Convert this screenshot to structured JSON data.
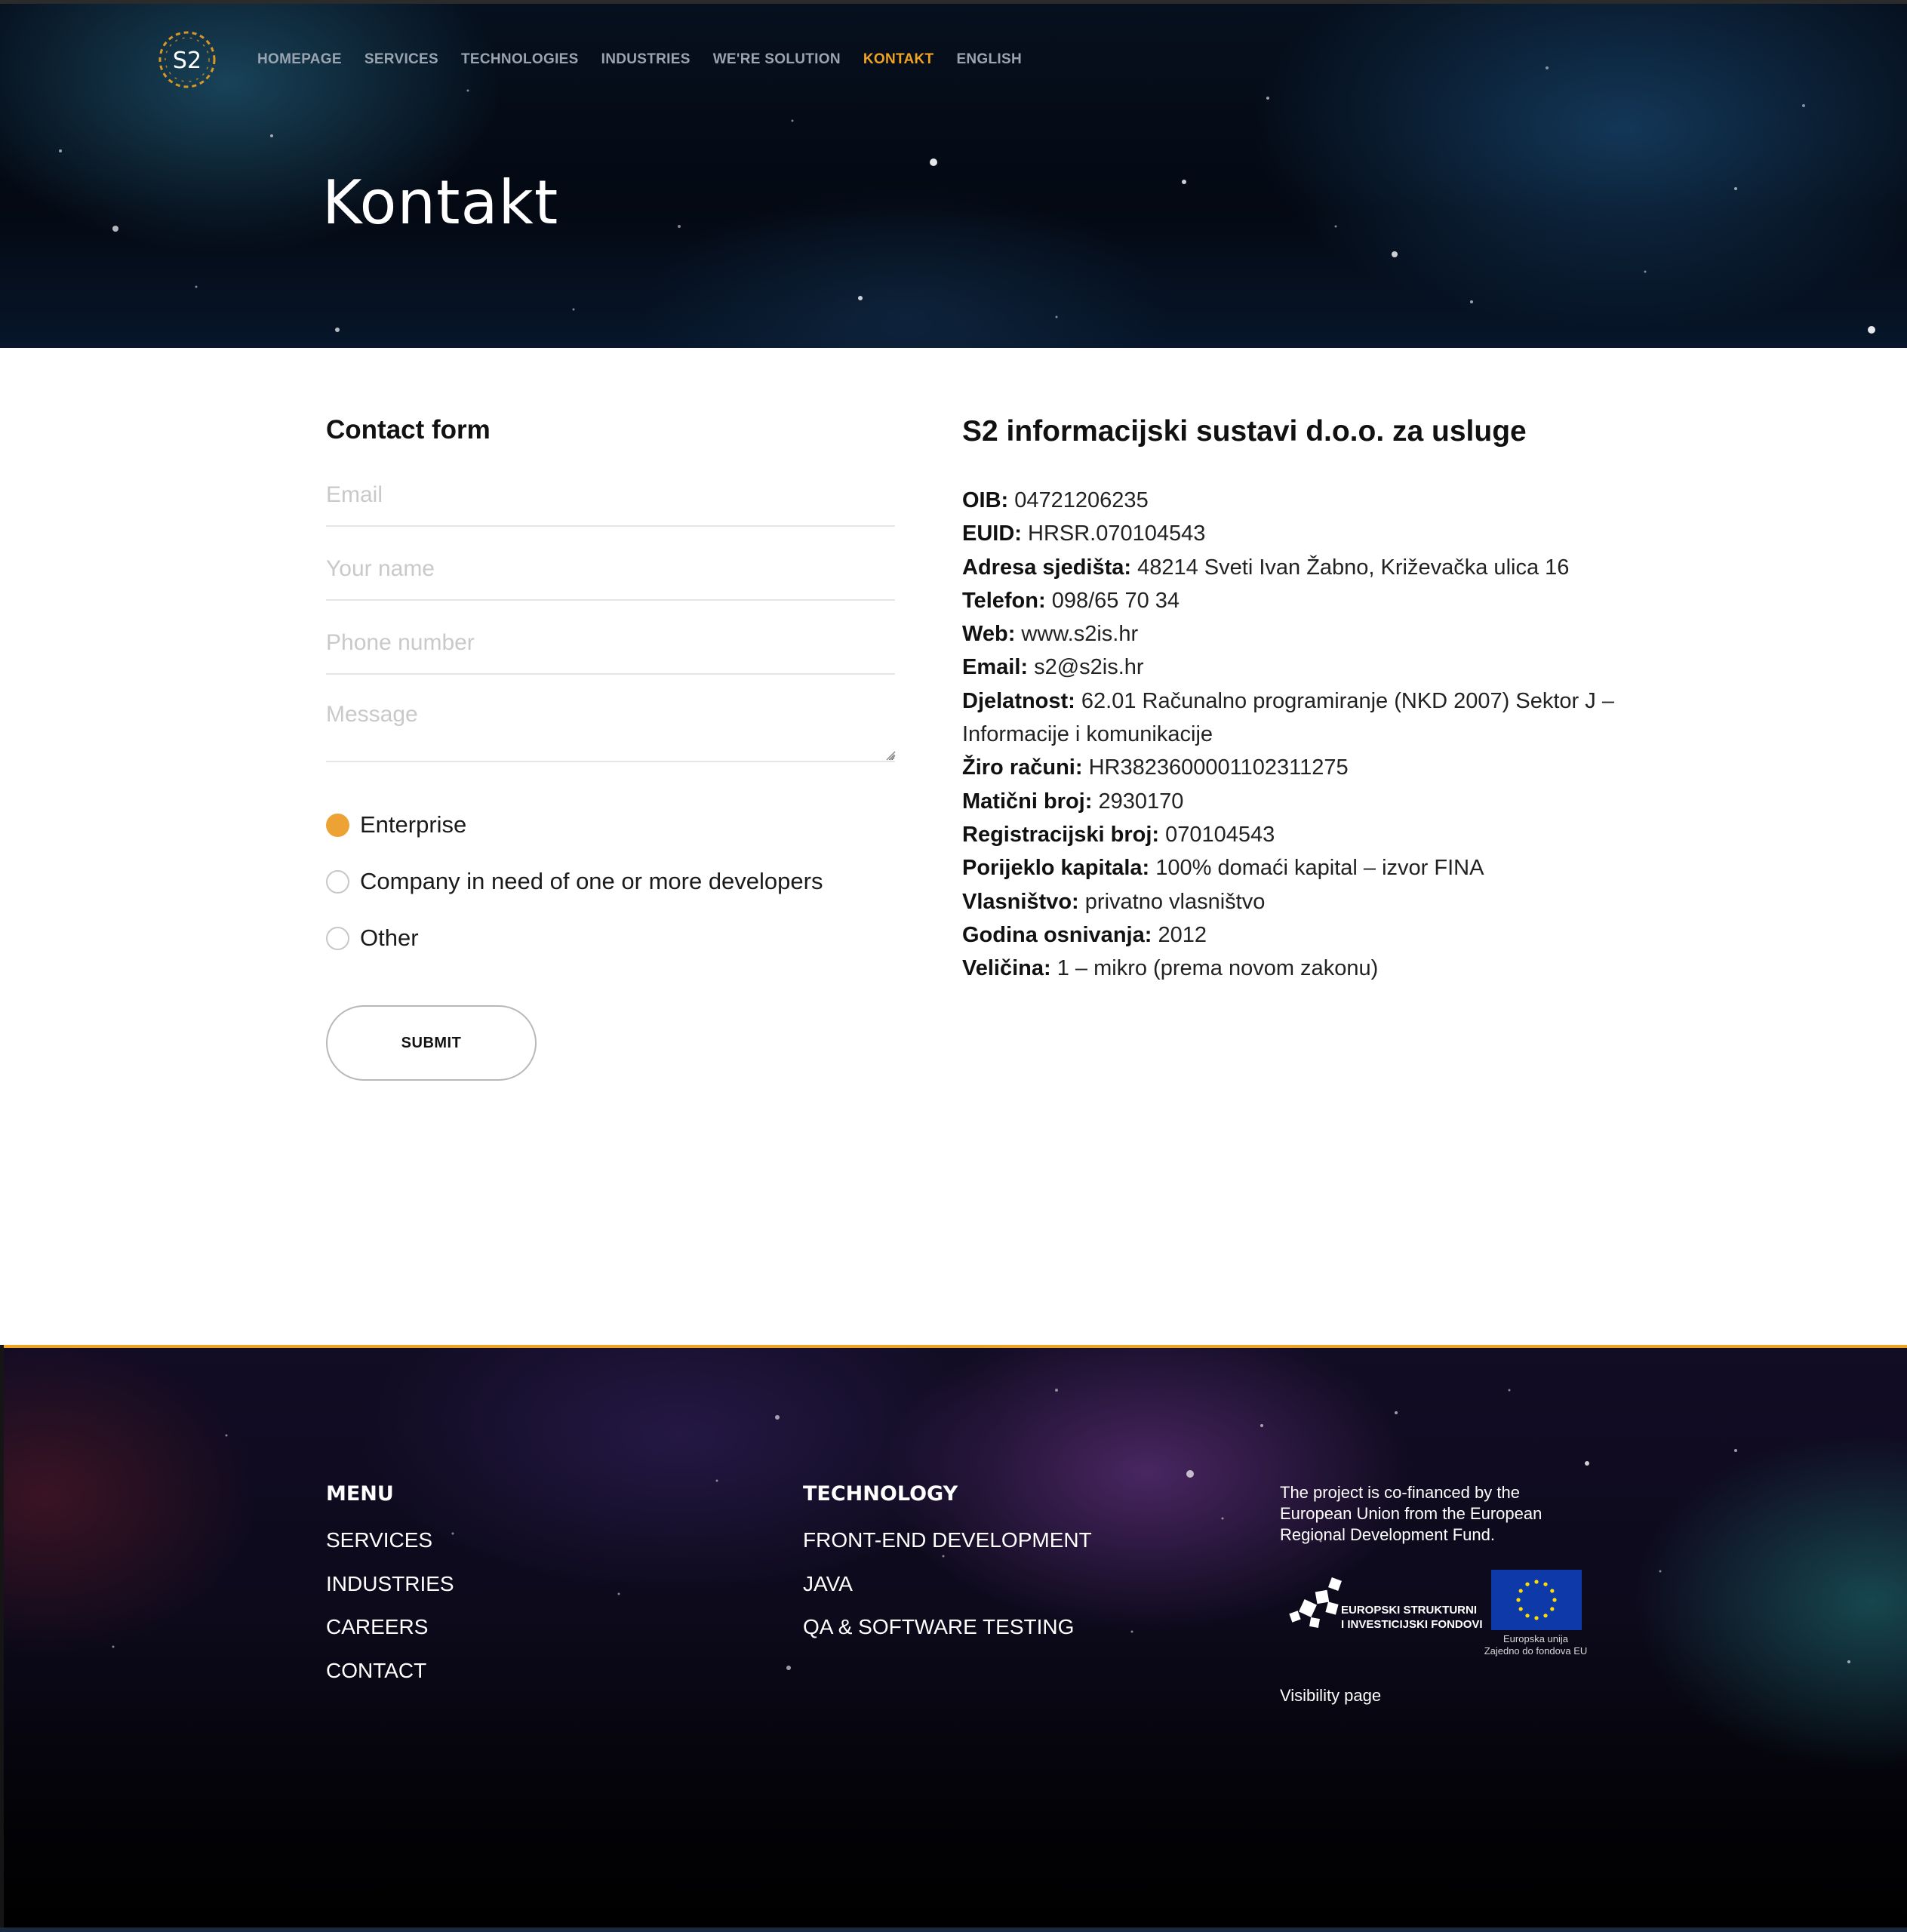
{
  "header": {
    "logo_text": "S2",
    "nav": [
      {
        "label": "HOMEPAGE",
        "active": false
      },
      {
        "label": "SERVICES",
        "active": false
      },
      {
        "label": "TECHNOLOGIES",
        "active": false
      },
      {
        "label": "INDUSTRIES",
        "active": false
      },
      {
        "label": "WE'RE SOLUTION",
        "active": false
      },
      {
        "label": "KONTAKT",
        "active": true
      },
      {
        "label": "ENGLISH",
        "active": false
      }
    ],
    "accent_color": "#f0a221"
  },
  "hero": {
    "title": "Kontakt"
  },
  "contact_form": {
    "title": "Contact form",
    "email_placeholder": "Email",
    "name_placeholder": "Your name",
    "phone_placeholder": "Phone number",
    "message_placeholder": "Message",
    "options": [
      {
        "label": "Enterprise",
        "checked": true
      },
      {
        "label": "Company in need of one or more developers",
        "checked": false
      },
      {
        "label": "Other",
        "checked": false
      }
    ],
    "submit_label": "SUBMIT"
  },
  "company": {
    "name": "S2 informacijski sustavi d.o.o. za usluge",
    "details": [
      {
        "label": "OIB:",
        "value": "04721206235"
      },
      {
        "label": "EUID:",
        "value": "HRSR.070104543"
      },
      {
        "label": "Adresa sjedišta:",
        "value": "48214 Sveti Ivan Žabno, Križevačka ulica 16"
      },
      {
        "label": "Telefon:",
        "value": "098/65 70 34"
      },
      {
        "label": "Web:",
        "value": "www.s2is.hr"
      },
      {
        "label": "Email:",
        "value": "s2@s2is.hr"
      },
      {
        "label": "Djelatnost:",
        "value": "62.01 Računalno programiranje (NKD 2007) Sektor J – Informacije i komunikacije"
      },
      {
        "label": "Žiro računi:",
        "value": "HR3823600001102311275"
      },
      {
        "label": "Matični broj:",
        "value": "2930170"
      },
      {
        "label": "Registracijski broj:",
        "value": "070104543"
      },
      {
        "label": "Porijeklo kapitala:",
        "value": "100% domaći kapital – izvor FINA"
      },
      {
        "label": "Vlasništvo:",
        "value": "privatno vlasništvo"
      },
      {
        "label": "Godina osnivanja:",
        "value": "2012"
      },
      {
        "label": "Veličina:",
        "value": "1 – mikro (prema novom zakonu)"
      }
    ]
  },
  "footer": {
    "menu": {
      "heading": "MENU",
      "items": [
        "SERVICES",
        "INDUSTRIES",
        "CAREERS",
        "CONTACT"
      ]
    },
    "technology": {
      "heading": "TECHNOLOGY",
      "items": [
        "FRONT-END DEVELOPMENT",
        "JAVA",
        "QA & SOFTWARE TESTING"
      ]
    },
    "eu_text": "The project is co-financed by the European Union from the European Regional Development Fund.",
    "esif_logo_line1": "EUROPSKI STRUKTURNI",
    "esif_logo_line2": "I INVESTICIJSKI FONDOVI",
    "eu_flag_caption_line1": "Europska unija",
    "eu_flag_caption_line2": "Zajedno do fondova EU",
    "eu_flag_color": "#0d3aa8",
    "visibility_link": "Visibility page"
  }
}
